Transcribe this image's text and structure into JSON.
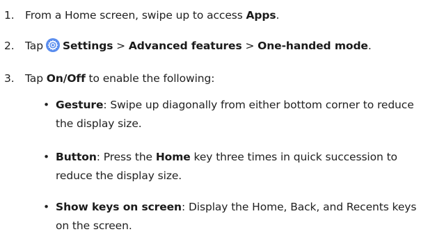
{
  "steps": [
    {
      "number": "1.",
      "text_before": "From a Home screen, swipe up to access ",
      "bold": "Apps",
      "text_after": "."
    },
    {
      "number": "2.",
      "tap": "Tap",
      "icon": "settings-gear-icon",
      "settings": "Settings",
      "separator": ">",
      "advanced": "Advanced features",
      "one_handed": "One-handed mode",
      "end": "."
    },
    {
      "number": "3.",
      "tap": "Tap ",
      "bold": "On/Off",
      "text_after": " to enable the following:"
    }
  ],
  "options": [
    {
      "bullet": "•",
      "title": "Gesture",
      "description": ": Swipe up diagonally from either bottom corner to reduce the display size."
    },
    {
      "bullet": "•",
      "title": "Button",
      "description_before": ": Press the ",
      "key": "Home",
      "description_after": " key three times in quick succession to reduce the display size."
    },
    {
      "bullet": "•",
      "title": "Show keys on screen",
      "description": ": Display the Home, Back, and Recents keys on the screen."
    }
  ],
  "colors": {
    "text": "#1f1f1f",
    "settings_icon": "#5a8dee"
  }
}
